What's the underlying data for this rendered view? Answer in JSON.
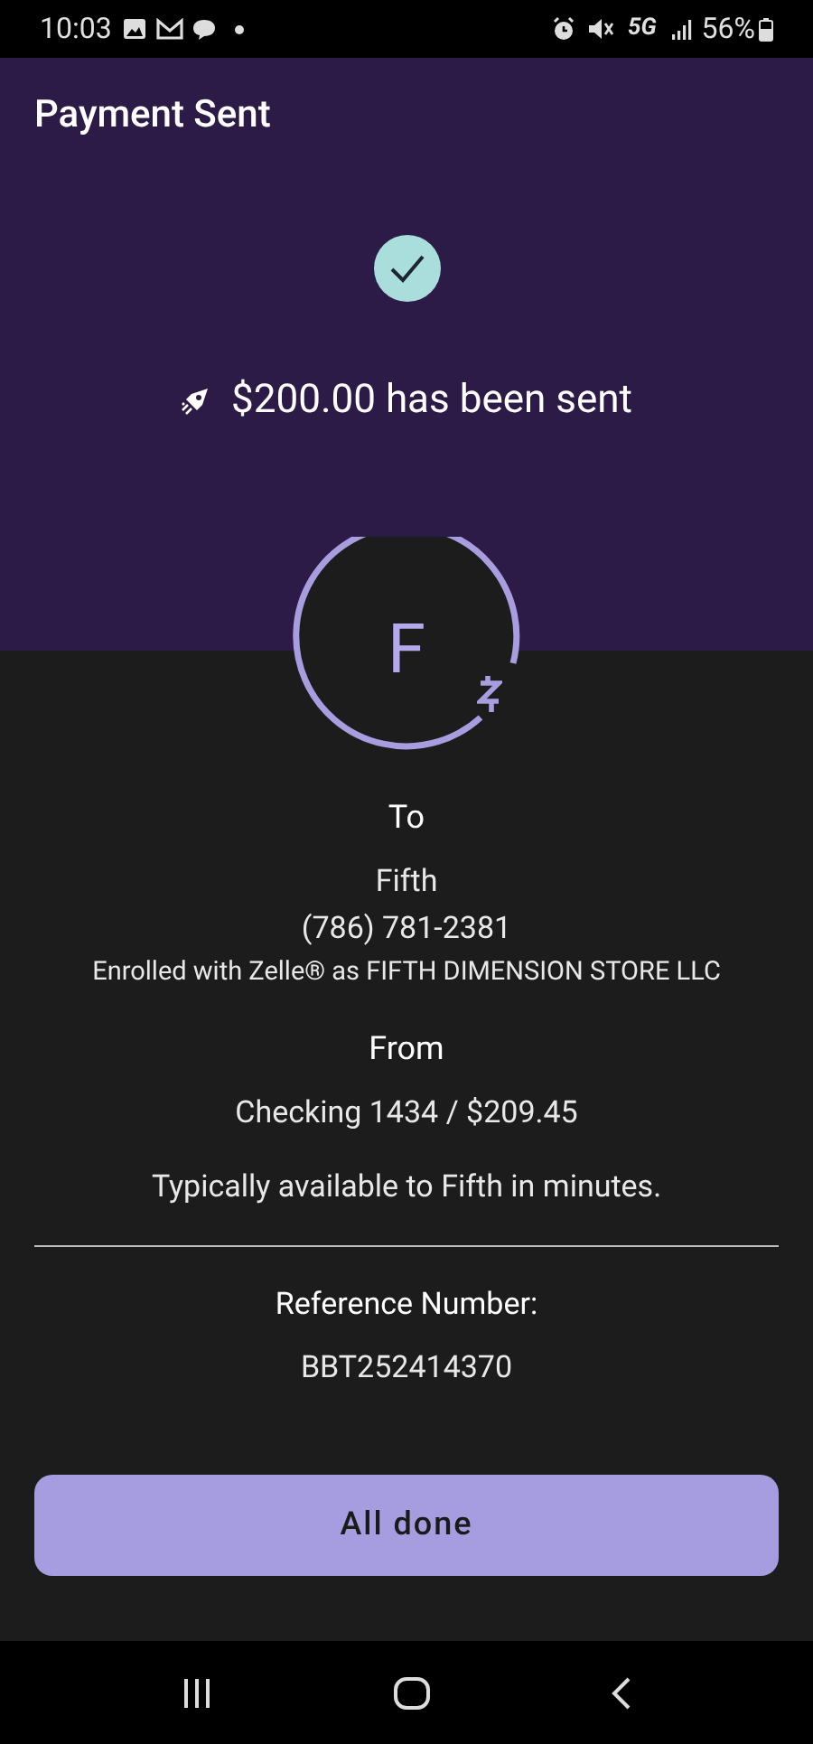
{
  "status_bar": {
    "time": "10:03",
    "network": "5G",
    "battery": "56%"
  },
  "title": "Payment Sent",
  "sent_message": "$200.00 has been sent",
  "recipient": {
    "initial": "F",
    "to_label": "To",
    "name": "Fifth",
    "phone": "(786) 781-2381",
    "enrollment": "Enrolled with Zelle® as FIFTH DIMENSION STORE LLC"
  },
  "source": {
    "from_label": "From",
    "account": "Checking 1434 / $209.45"
  },
  "availability": "Typically available to Fifth in minutes.",
  "reference": {
    "label": "Reference Number:",
    "number": "BBT252414370"
  },
  "done_button": "All done"
}
